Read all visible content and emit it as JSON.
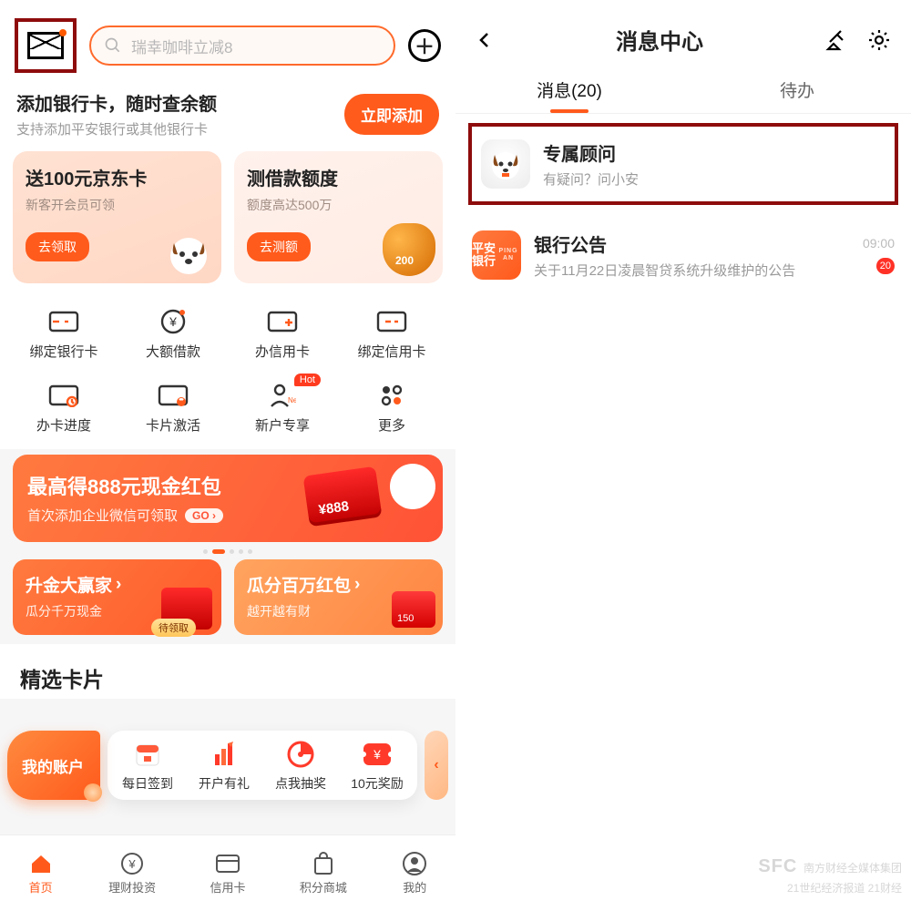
{
  "left": {
    "search_placeholder": "瑞幸咖啡立减8",
    "addcard": {
      "title": "添加银行卡，随时查余额",
      "sub": "支持添加平安银行或其他银行卡",
      "btn": "立即添加"
    },
    "promoA": {
      "title": "送100元京东卡",
      "sub": "新客开会员可领",
      "btn": "去领取"
    },
    "promoB": {
      "title": "测借款额度",
      "sub": "额度高达500万",
      "btn": "去测额",
      "coin_label": "200"
    },
    "grid": [
      {
        "label": "绑定银行卡"
      },
      {
        "label": "大额借款"
      },
      {
        "label": "办信用卡"
      },
      {
        "label": "绑定信用卡"
      },
      {
        "label": "办卡进度"
      },
      {
        "label": "卡片激活"
      },
      {
        "label": "新户专享",
        "hot": "Hot"
      },
      {
        "label": "更多"
      }
    ],
    "banner": {
      "title": "最高得888元现金红包",
      "sub": "首次添加企业微信可领取",
      "go": "GO",
      "amount": "¥888"
    },
    "small": [
      {
        "title": "升金大赢家",
        "sub": "瓜分千万现金",
        "tag": "待领取"
      },
      {
        "title": "瓜分百万红包",
        "sub": "越开越有财",
        "badge": "150"
      }
    ],
    "section_title": "精选卡片",
    "float": {
      "main": "我的账户",
      "items": [
        "每日签到",
        "开户有礼",
        "点我抽奖",
        "10元奖励"
      ]
    },
    "tabs": [
      "首页",
      "理财投资",
      "信用卡",
      "积分商城",
      "我的"
    ]
  },
  "right": {
    "title": "消息中心",
    "tabs": {
      "messages": "消息(20)",
      "todo": "待办"
    },
    "rows": [
      {
        "title": "专属顾问",
        "sub": "有疑问？问小安"
      },
      {
        "title": "银行公告",
        "sub": "关于11月22日凌晨智贷系统升级维护的公告",
        "time": "09:00",
        "badge": "20",
        "bank_label": "平安\n银行",
        "bank_small": "PING AN"
      }
    ]
  },
  "watermark": {
    "l1": "SFC",
    "l2": "南方财经全媒体集团",
    "l3": "21世纪经济报道  21财经"
  }
}
